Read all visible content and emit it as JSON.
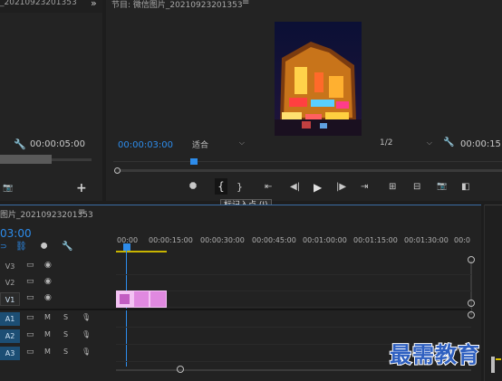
{
  "source_monitor": {
    "title_fragment": "_20210923201353",
    "timecode": "00:00:05:00"
  },
  "program_monitor": {
    "title": "节目: 微信图片_20210923201353",
    "timecode": "00:00:03:00",
    "zoom": "适合",
    "resolution": "1/2",
    "duration_fragment": "00:00:15:",
    "playhead_fraction": 0.2
  },
  "transport": {
    "tooltip": "标记入点 (I)",
    "buttons": [
      "marker-add",
      "mark-in",
      "mark-out",
      "go-to-in",
      "step-back",
      "play",
      "step-forward",
      "go-to-out",
      "insert",
      "overwrite",
      "export-frame",
      "compare"
    ]
  },
  "timeline": {
    "title": "图片_20210923201353",
    "timecode": "03:00",
    "ruler": [
      "00:00",
      "00:00:15:00",
      "00:00:30:00",
      "00:00:45:00",
      "00:01:00:00",
      "00:01:15:00",
      "00:01:30:00",
      "00:0"
    ],
    "tracks": [
      {
        "name": "V3",
        "type": "video"
      },
      {
        "name": "V2",
        "type": "video"
      },
      {
        "name": "V1",
        "type": "video"
      },
      {
        "name": "A1",
        "type": "audio",
        "m": "M",
        "s": "S"
      },
      {
        "name": "A2",
        "type": "audio",
        "m": "M",
        "s": "S"
      },
      {
        "name": "A3",
        "type": "audio",
        "m": "M",
        "s": "S"
      }
    ]
  },
  "watermark": "最需教育",
  "colors": {
    "accent_blue": "#2d8ceb",
    "clip_pink": "#e089e0",
    "track_highlight": "#1c4e74"
  }
}
